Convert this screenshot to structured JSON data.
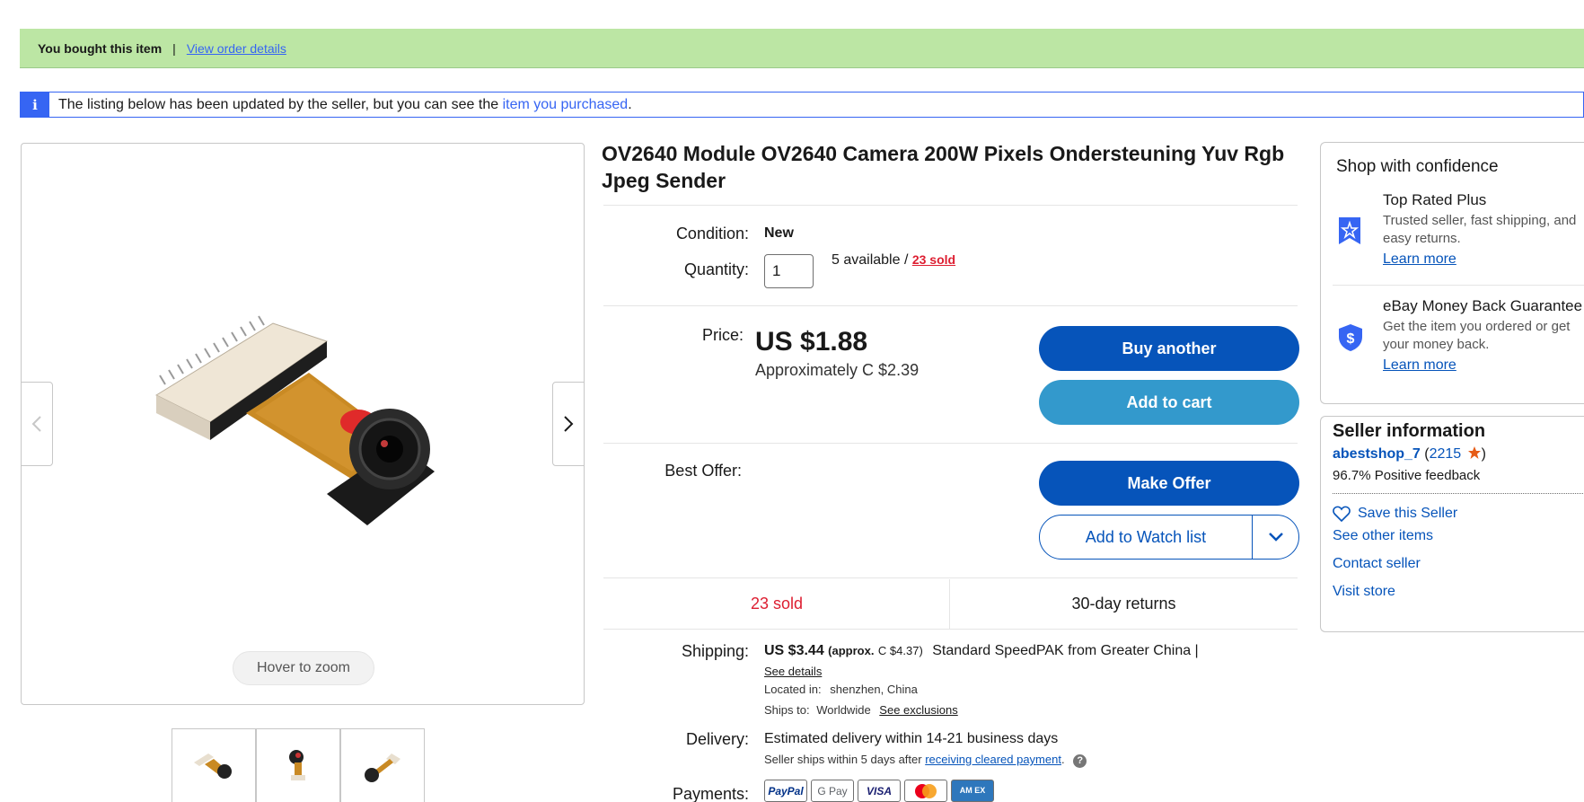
{
  "banner": {
    "bought_text": "You bought this item",
    "separator": "|",
    "view_order_link": "View order details"
  },
  "notice": {
    "icon_label": "i",
    "text": "The listing below has been updated by the seller, but you can see the ",
    "link": "item you purchased",
    "tail": "."
  },
  "gallery": {
    "zoom_hint": "Hover to zoom",
    "prev_icon": "chevron-left-icon",
    "next_icon": "chevron-right-icon"
  },
  "item": {
    "title": "OV2640 Module OV2640 Camera 200W Pixels Ondersteuning Yuv Rgb Jpeg Sender",
    "condition_label": "Condition:",
    "condition_value": "New",
    "quantity_label": "Quantity:",
    "quantity_value": "1",
    "available_text": "5 available / ",
    "sold_link": "23 sold",
    "price_label": "Price:",
    "price": "US $1.88",
    "approx_price": "Approximately C $2.39",
    "best_offer_label": "Best Offer:"
  },
  "buttons": {
    "buy_another": "Buy another",
    "add_to_cart": "Add to cart",
    "make_offer": "Make Offer",
    "add_to_watch": "Add to Watch list"
  },
  "stats": {
    "sold": "23 sold",
    "returns": "30-day returns"
  },
  "shipping": {
    "label": "Shipping:",
    "price": "US $3.44",
    "approx": "(approx.",
    "approx_value": "C $4.37)",
    "method": "Standard SpeedPAK from Greater China |",
    "see_details": "See details",
    "located_label": "Located in:",
    "located_value": "shenzhen, China",
    "ships_to_label": "Ships to:",
    "ships_to_value": "Worldwide",
    "see_exclusions": "See exclusions"
  },
  "delivery": {
    "label": "Delivery:",
    "estimate": "Estimated delivery within 14-21 business days",
    "note_prefix": "Seller ships within 5 days after ",
    "note_link": "receiving cleared payment",
    "note_suffix": ".",
    "help_icon": "?"
  },
  "payments": {
    "label": "Payments:",
    "methods": [
      "PayPal",
      "G Pay",
      "VISA",
      "",
      "AM EX"
    ]
  },
  "confidence": {
    "heading": "Shop with confidence",
    "top_rated_title": "Top Rated Plus",
    "top_rated_desc_1": "Trusted seller, fast shipping, and",
    "top_rated_desc_2": "easy returns.",
    "learn_more_1": "Learn more",
    "mbg_title": "eBay Money Back Guarantee",
    "mbg_desc_1": "Get the item you ordered or get",
    "mbg_desc_2": "your money back.",
    "learn_more_2": "Learn more"
  },
  "seller": {
    "heading": "Seller information",
    "name": "abestshop_7",
    "feedback_open": " (",
    "feedback_count": "2215",
    "feedback_close": ")",
    "positive": "96.7% Positive feedback",
    "save_seller": "Save this Seller",
    "see_other": "See other items",
    "contact": "Contact seller",
    "visit_store": "Visit store"
  },
  "colors": {
    "banner_green": "#bce6a4",
    "ebay_blue": "#0654ba",
    "cart_blue": "#3399cc",
    "link_blue": "#3665f3",
    "sold_red": "#dd1e31"
  }
}
